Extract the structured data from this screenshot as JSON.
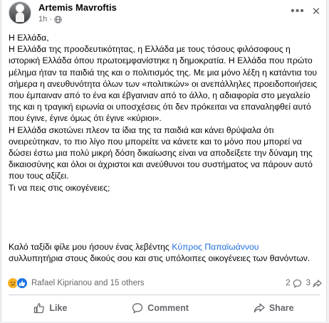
{
  "post": {
    "author": "Artemis Mavroftis",
    "time": "1h",
    "dot": "·",
    "icons": {
      "privacy": "globe-icon",
      "more": "more-options-icon",
      "close": "close-icon"
    },
    "body": "Η Ελλάδα,\nΗ Ελλάδα της προοδευτικότητας, η Ελλάδα με τους τόσους φιλόσοφους η ιστορική Ελλάδα όπου πρωτοεμφανίστηκε η δημοκρατία. Η Ελλάδα που πρώτο μέλημα ήταν τα παιδιά της και ο πολιτισμός της. Με μια μόνο λέξη η κατάντια του σήμερα η ανευθυνότητα όλων των «πολιτικών» οι ανεπάλληλες προειδοποιήσεις που έμπαιναν από το ένα και έβγαινιαν από το άλλο, η αδιαφορία στο μεγαλείο της και η τραγική ειρωνία οι υποσχέσεις ότι δεν πρόκειται να επαναληφθεί αυτό που έγινε, έγινε όμως ότι έγινε «κύριοι».\nΗ Ελλάδα σκοτώνει πλεον τα ίδια της τα παιδιά και κάνει θρύψαλα ότι ονειρεύτηκαν, το πιο λίγο που μπορείτε να κάνετε και το μόνο που μπορεί να δώσει έστω μια πολύ μικρή δόση δικαίωσης είναι να αποδείξετε την δύναμη της δικαιοσύνης και όλοι οι άχριστοι και ανεύθυνοι του συστήματος να πάρουν αυτό που τους αξίζει.\nΤι να πεις στις οικογένειες;",
    "caption_before": "Καλό ταξίδι φίλε μου ήσουν ένας λεβέντης ",
    "mention": "Κύπρος Παπαϊωάννου",
    "caption_after": "συλλυπητήρια στους δικούς σου και στις υπόλοιπες οικογένειες των θανόντων."
  },
  "reactions": {
    "summary": "Rafael Kiprianou and 15 others",
    "comments_count": "2",
    "shares_count": "3",
    "colors": {
      "sad": "#f7b125",
      "like": "#1b74e4"
    }
  },
  "actions": {
    "like": "Like",
    "comment": "Comment",
    "share": "Share"
  }
}
